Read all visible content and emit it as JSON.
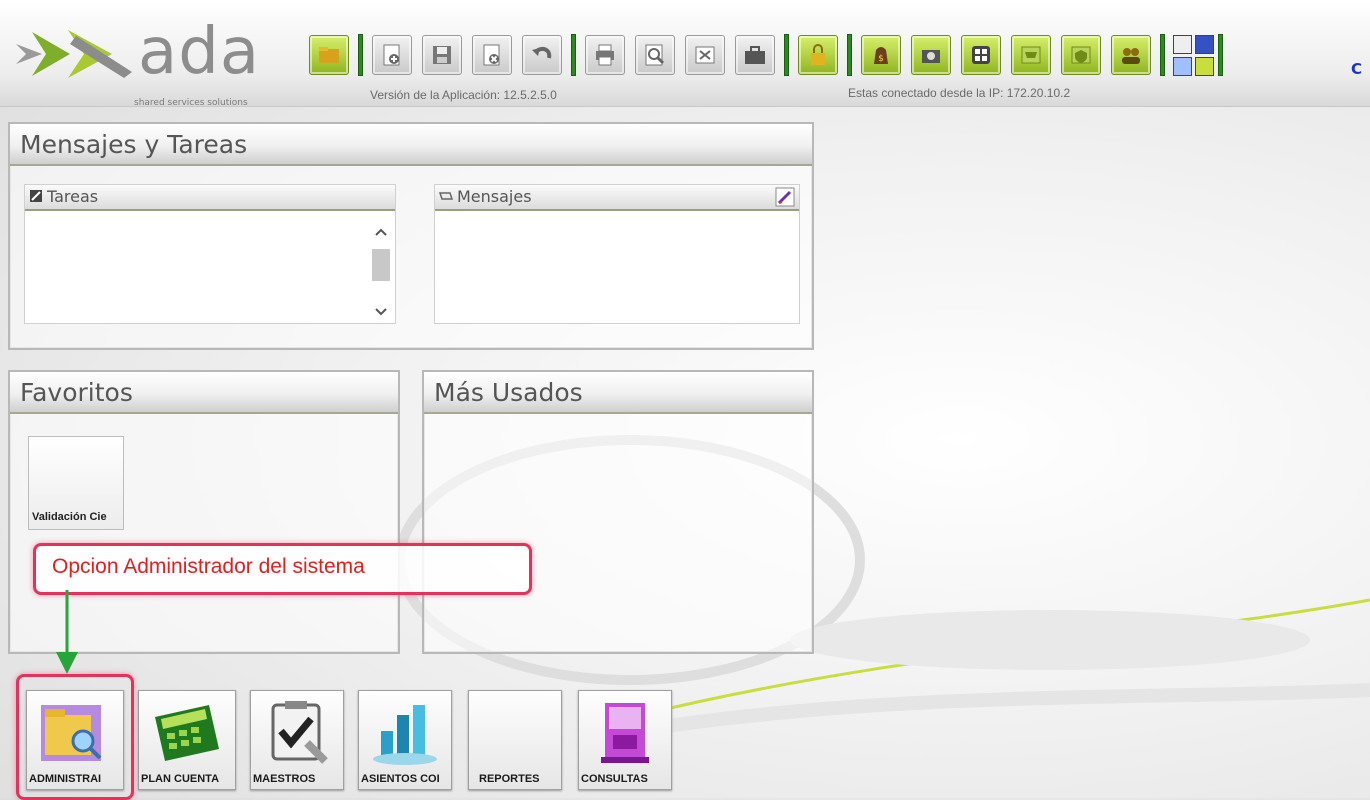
{
  "header": {
    "logo_text": "ada",
    "logo_subtitle": "shared services solutions",
    "version_text": "Versión de la Aplicación: 12.5.2.5.0",
    "ip_text": "Estas conectado desde la IP: 172.20.10.2",
    "cut_label": "C"
  },
  "toolbar": {
    "icons": [
      "folder-icon",
      "new-document-icon",
      "save-icon",
      "delete-icon",
      "undo-icon",
      "print-icon",
      "preview-icon",
      "export-icon",
      "briefcase-icon",
      "lock-icon",
      "money-icon",
      "camera-icon",
      "calculator-icon",
      "cart-icon",
      "shield-icon",
      "users-icon"
    ]
  },
  "mensajes_tareas": {
    "title": "Mensajes y Tareas",
    "tareas_label": "Tareas",
    "mensajes_label": "Mensajes"
  },
  "favoritos": {
    "title": "Favoritos",
    "items": [
      {
        "label": "Validación Cie"
      }
    ]
  },
  "mas_usados": {
    "title": "Más Usados"
  },
  "annotation": {
    "text": "Opcion Administrador del sistema"
  },
  "bottom_bar": {
    "items": [
      {
        "label": "ADMINISTRAI"
      },
      {
        "label": "PLAN CUENTA"
      },
      {
        "label": "MAESTROS"
      },
      {
        "label": "ASIENTOS COI"
      },
      {
        "label": "REPORTES"
      },
      {
        "label": "CONSULTAS"
      }
    ]
  },
  "colors": {
    "accent_green": "#8fb51f",
    "separator_green": "#2c8a1f",
    "annotation_red": "#e8305c"
  }
}
